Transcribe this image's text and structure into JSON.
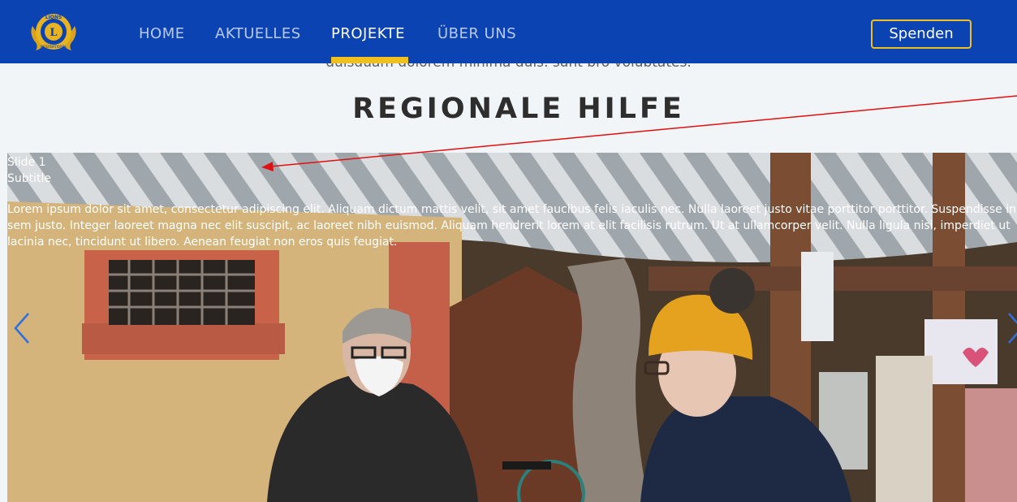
{
  "nav": {
    "links": [
      {
        "label": "HOME",
        "active": false
      },
      {
        "label": "AKTUELLES",
        "active": false
      },
      {
        "label": "PROJEKTE",
        "active": true
      },
      {
        "label": "ÜBER UNS",
        "active": false
      }
    ],
    "donate_label": "Spenden",
    "logo_icon": "lions-international-logo"
  },
  "intro": {
    "cutoff_text": "quisquam dolorem minima quis, sunt pro voluptates."
  },
  "section": {
    "heading": "REGIONALE HILFE"
  },
  "slider": {
    "current": {
      "title": "Slide 1",
      "subtitle": "Subtitle",
      "body": "Lorem ipsum dolor sit amet, consectetur adipiscing elit. Aliquam dictum mattis velit, sit amet faucibus felis iaculis nec. Nulla laoreet justo vitae porttitor porttitor. Suspendisse in sem justo. Integer laoreet magna nec elit suscipit, ac laoreet nibh euismod. Aliquam hendrerit lorem at elit facilisis rutrum. Ut at ullamcorper velit. Nulla ligula nisi, imperdiet ut lacinia nec, tincidunt ut libero. Aenean feugiat non eros quis feugiat."
    },
    "prev_icon": "chevron-left-icon",
    "next_icon": "chevron-right-icon"
  },
  "colors": {
    "navbar": "#0c43b3",
    "accent": "#f0c01e",
    "annotation": "#e01010"
  }
}
